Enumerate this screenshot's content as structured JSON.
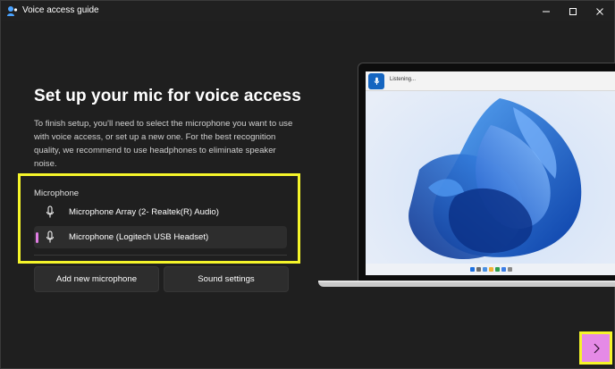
{
  "window": {
    "title": "Voice access guide",
    "controls": [
      "minimize",
      "maximize",
      "close"
    ]
  },
  "main": {
    "heading": "Set up your mic for voice access",
    "description": "To finish setup, you'll need to select the microphone you want to use with voice access, or set up a new one. For the best recognition quality, we recommend to use headphones to eliminate speaker noise.",
    "microphone_label": "Microphone",
    "microphones": [
      {
        "label": "Microphone Array (2- Realtek(R) Audio)",
        "selected": false
      },
      {
        "label": "Microphone (Logitech USB Headset)",
        "selected": true
      }
    ],
    "add_button": "Add new microphone",
    "sound_button": "Sound settings"
  },
  "preview": {
    "listening_text": "Listening..."
  },
  "colors": {
    "background": "#1f1f1f",
    "accent": "#e58ae6",
    "highlight": "#f5f52a"
  },
  "icons": [
    "app-icon",
    "minimize-icon",
    "maximize-icon",
    "close-icon",
    "microphone-icon",
    "chevron-right-icon"
  ]
}
